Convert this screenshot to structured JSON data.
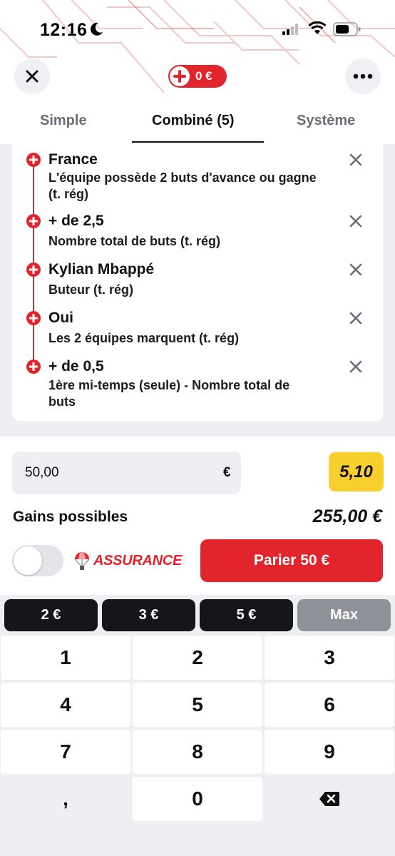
{
  "status_bar": {
    "time": "12:16"
  },
  "header": {
    "coupon_amount": "0 €"
  },
  "tabs": [
    {
      "label": "Simple",
      "active": false
    },
    {
      "label": "Combiné (5)",
      "active": true
    },
    {
      "label": "Système",
      "active": false
    }
  ],
  "selections": [
    {
      "title": "France",
      "desc": "L'équipe possède 2 buts d'avance ou gagne (t. rég)"
    },
    {
      "title": "+ de 2,5",
      "desc": "Nombre total de buts (t. rég)"
    },
    {
      "title": "Kylian Mbappé",
      "desc": "Buteur (t. rég)"
    },
    {
      "title": "Oui",
      "desc": "Les 2 équipes marquent (t. rég)"
    },
    {
      "title": "+ de 0,5",
      "desc": "1ère mi-temps (seule) - Nombre total de buts"
    }
  ],
  "stake": {
    "value": "50,00",
    "currency": "€"
  },
  "odds": "5,10",
  "gains": {
    "label": "Gains possibles",
    "value": "255,00 €"
  },
  "insurance": {
    "label": "ASSURANCE",
    "enabled": false
  },
  "bet_button": "Parier 50 €",
  "quick_amounts": [
    "2 €",
    "3 €",
    "5 €",
    "Max"
  ],
  "keypad": [
    "1",
    "2",
    "3",
    "4",
    "5",
    "6",
    "7",
    "8",
    "9",
    ",",
    "0"
  ],
  "colors": {
    "accent": "#e2242d",
    "odds_bg": "#f8d02e",
    "dark": "#15161a",
    "panel": "#eeeff2"
  }
}
